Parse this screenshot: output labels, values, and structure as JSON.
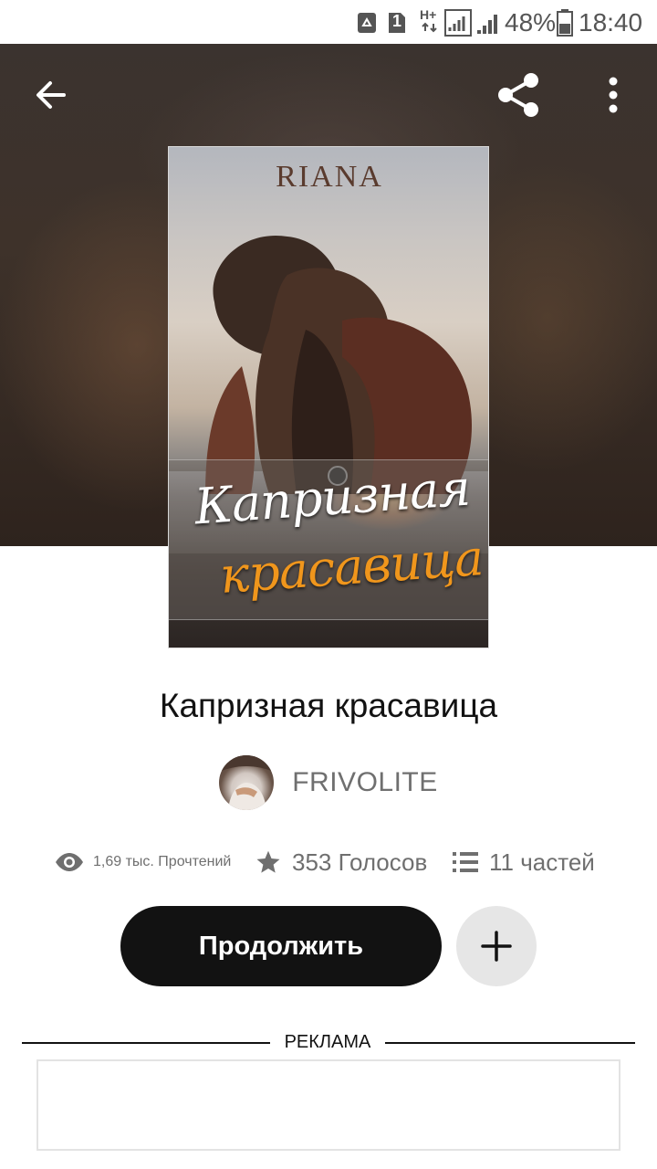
{
  "status_bar": {
    "battery_percent": "48%",
    "time": "18:40",
    "sim_slot": "1",
    "network": "H+"
  },
  "header": {
    "back_icon": "arrow-back-icon",
    "share_icon": "share-icon",
    "more_icon": "more-vertical-icon"
  },
  "cover": {
    "author_mark": "RIANA",
    "title_line_1": "Капризная",
    "title_line_2": "красавица",
    "title_line_2_color": "#f0961c"
  },
  "book": {
    "title": "Капризная красавица",
    "author": "FRIVOLITE"
  },
  "stats": {
    "reads": "1,69 тыс. Прочтений",
    "votes": "353 Голосов",
    "parts": "11 частей"
  },
  "actions": {
    "continue_label": "Продолжить",
    "add_icon": "plus-icon"
  },
  "ad": {
    "label": "РЕКЛАМА"
  },
  "colors": {
    "primary_button": "#121212",
    "secondary_text": "#6f6f6f",
    "add_button_bg": "#e6e6e6"
  }
}
